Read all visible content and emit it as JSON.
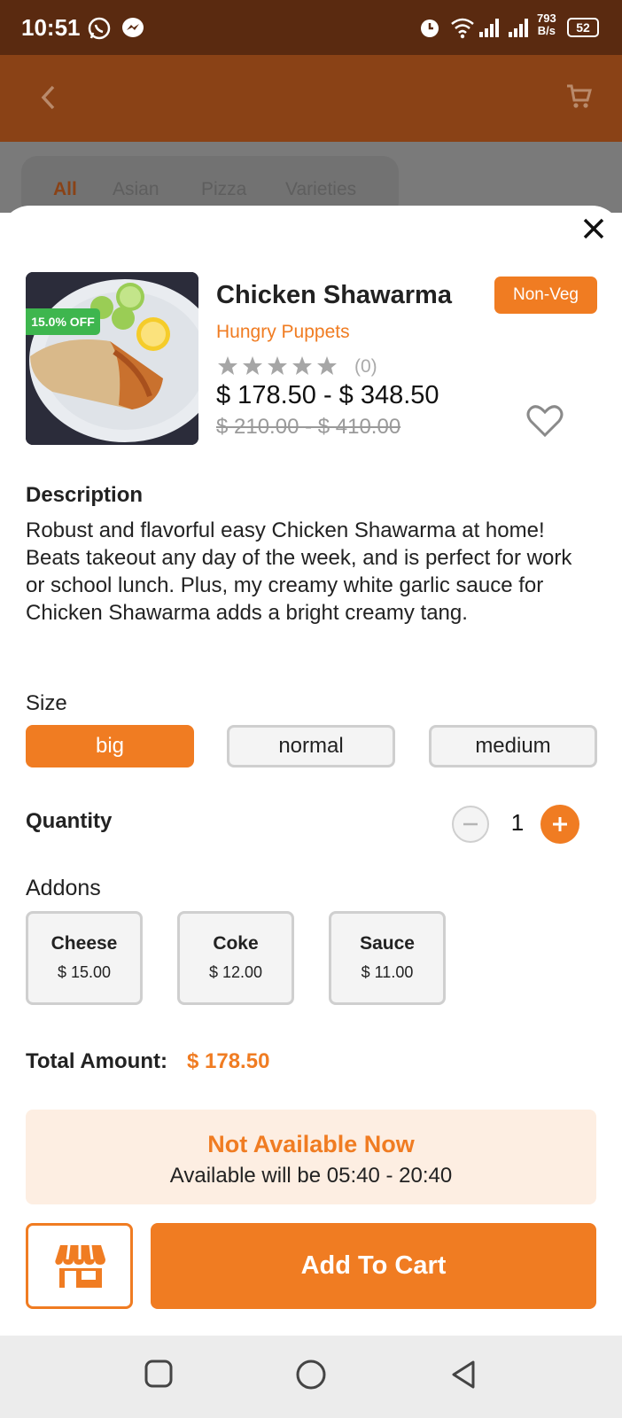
{
  "status_bar": {
    "time": "10:51",
    "net_speed_value": "793",
    "net_speed_unit": "B/s",
    "battery": "52"
  },
  "categories": {
    "tabs": [
      {
        "label": "All",
        "active": true
      },
      {
        "label": "Asian",
        "active": false
      },
      {
        "label": "Pizza",
        "active": false
      },
      {
        "label": "Varieties",
        "active": false
      }
    ]
  },
  "product": {
    "name": "Chicken Shawarma",
    "discount_badge": "15.0% OFF",
    "type_badge": "Non-Veg",
    "restaurant": "Hungry Puppets",
    "rating_stars": 0,
    "rating_count": "(0)",
    "price_range": "$ 178.50 - $ 348.50",
    "original_price_range": "$ 210.00 - $ 410.00"
  },
  "description": {
    "title": "Description",
    "text": "Robust and flavorful easy Chicken Shawarma at home! Beats takeout any day of the week, and is perfect for work or school lunch. Plus, my creamy white garlic sauce for Chicken Shawarma adds a bright creamy tang."
  },
  "size": {
    "title": "Size",
    "options": [
      {
        "label": "big",
        "selected": true
      },
      {
        "label": "normal",
        "selected": false
      },
      {
        "label": "medium",
        "selected": false
      }
    ]
  },
  "quantity": {
    "title": "Quantity",
    "value": "1"
  },
  "addons": {
    "title": "Addons",
    "items": [
      {
        "name": "Cheese",
        "price": "$ 15.00"
      },
      {
        "name": "Coke",
        "price": "$ 12.00"
      },
      {
        "name": "Sauce",
        "price": "$ 11.00"
      }
    ]
  },
  "total": {
    "label": "Total Amount:",
    "value": "$ 178.50"
  },
  "availability": {
    "title": "Not Available Now",
    "subtitle": "Available will be 05:40 - 20:40"
  },
  "actions": {
    "add_to_cart": "Add To Cart"
  },
  "colors": {
    "accent": "#f07c22",
    "discount": "#3eb64e",
    "status_bar": "#5a2a10"
  }
}
